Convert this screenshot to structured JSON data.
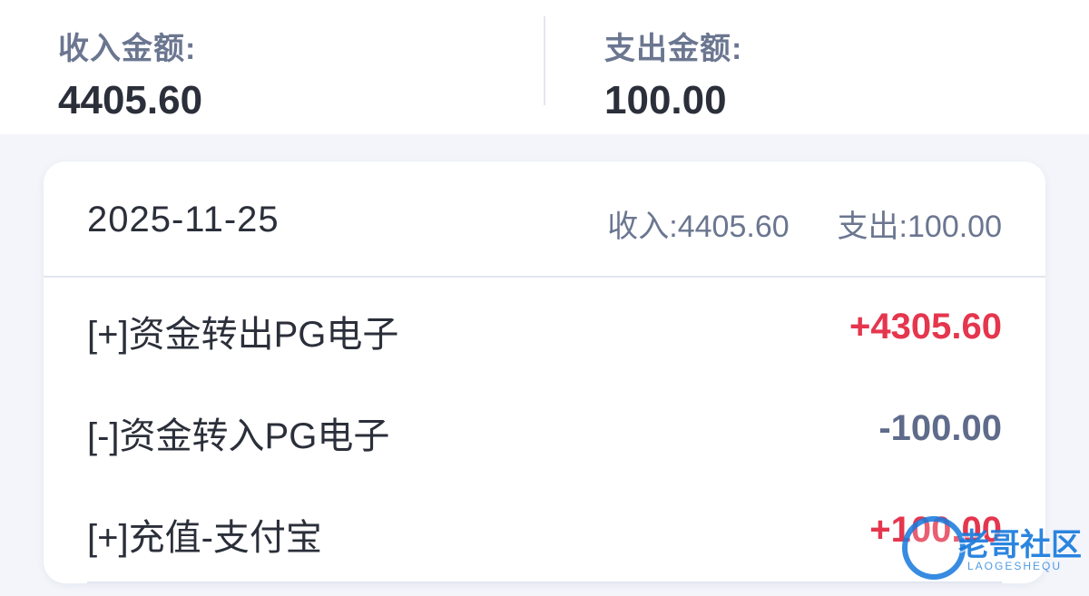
{
  "summary": {
    "income_label": "收入金额:",
    "income_value": "4405.60",
    "expense_label": "支出金额:",
    "expense_value": "100.00"
  },
  "card": {
    "date": "2025-11-25",
    "totals": {
      "income_label": "收入:",
      "income_value": "4405.60",
      "expense_label": "支出:",
      "expense_value": "100.00"
    },
    "items": [
      {
        "title": "[+]资金转出PG电子",
        "amount": "+4305.60",
        "kind": "income"
      },
      {
        "title": "[-]资金转入PG电子",
        "amount": "-100.00",
        "kind": "expense"
      },
      {
        "title": "[+]充值-支付宝",
        "amount": "+100.00",
        "kind": "income"
      }
    ]
  },
  "watermark": {
    "text": "老哥社区",
    "subtext": "LAOGESHEQU"
  },
  "colors": {
    "income": "#e5364e",
    "expense": "#5f6b8b",
    "muted": "#6b7690",
    "text": "#2b2f3a"
  }
}
